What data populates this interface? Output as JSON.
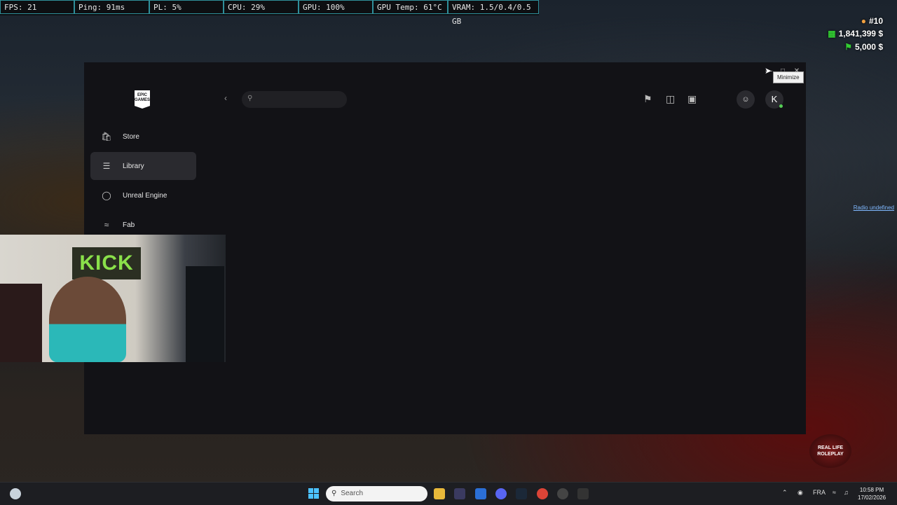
{
  "perf_overlay": {
    "fps": "FPS: 21",
    "ping": "Ping: 91ms",
    "pl": "PL: 5%",
    "cpu": "CPU: 29%",
    "gpu": "GPU: 100%",
    "gpu_temp": "GPU Temp: 61°C",
    "vram": "VRAM: 1.5/0.4/0.5 GB"
  },
  "game_hud": {
    "player_rank": "#10",
    "cash": "1,841,399 $",
    "bank": "5,000 $",
    "radio_link": "Radio undefined",
    "server_logo": "REAL LIFE ROLEPLAY"
  },
  "epic_window": {
    "tooltip": "Minimize",
    "logo_text": "EPIC GAMES",
    "search": {
      "placeholder": ""
    },
    "avatar_initial": "K",
    "nav": [
      {
        "label": "Store",
        "icon": "store-bag-icon"
      },
      {
        "label": "Library",
        "icon": "library-icon",
        "active": true
      },
      {
        "label": "Unreal Engine",
        "icon": "unreal-engine-icon"
      },
      {
        "label": "Fab",
        "icon": "fab-icon"
      }
    ],
    "top_icons": [
      "wishlist-bookmark-icon",
      "gift-icon",
      "cart-icon",
      "friends-icon"
    ]
  },
  "webcam": {
    "sign_text": "KICK"
  },
  "taskbar": {
    "search_label": "Search",
    "language": "FRA",
    "time": "10:58 PM",
    "date": "17/02/2026"
  }
}
